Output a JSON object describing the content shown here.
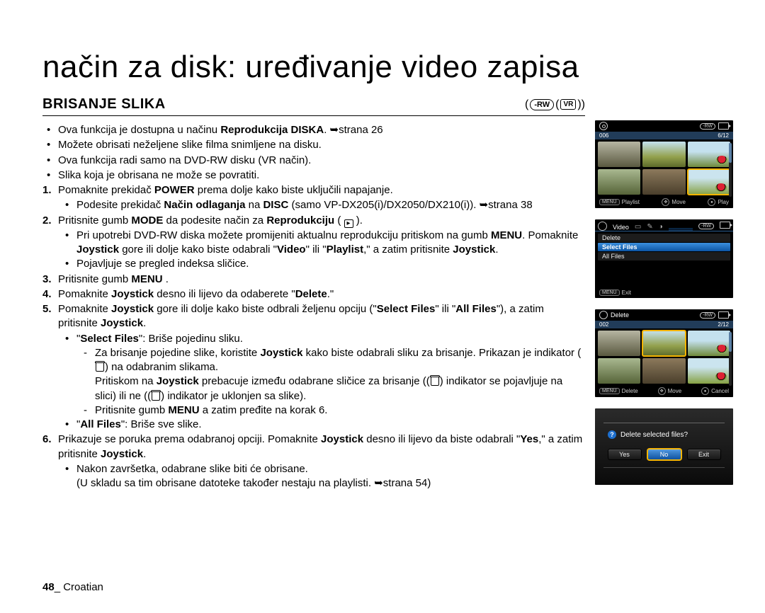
{
  "title": "način za disk: uređivanje video zapisa",
  "section_heading": "BRISANJE SLIKA",
  "badges": {
    "rw": "-RW",
    "vr": "VR"
  },
  "bullets": {
    "b1a": "Ova funkcija je dostupna u načinu ",
    "b1b": "Reprodukcija DISKA",
    "b1c": ". ➥strana 26",
    "b2": "Možete obrisati neželjene slike filma snimljene na disku.",
    "b3": "Ova funkcija radi samo na DVD-RW disku (VR način).",
    "b4": "Slika koja je obrisana ne može se povratiti."
  },
  "steps": {
    "s1a": "Pomaknite prekidač ",
    "s1b": "POWER",
    "s1c": " prema dolje kako biste uključili napajanje.",
    "s1s1a": "Podesite prekidač ",
    "s1s1b": "Način odlaganja",
    "s1s1c": " na ",
    "s1s1d": "DISC",
    "s1s1e": " (samo VP-DX205(i)/DX2050/DX210(i)). ➥strana 38",
    "s2a": "Pritisnite gumb ",
    "s2b": "MODE",
    "s2c": " da podesite način za ",
    "s2d": "Reprodukciju",
    "s2e": " ( ",
    "s2s1a": "Pri upotrebi DVD-RW diska možete promijeniti aktualnu reprodukciju pritiskom na gumb ",
    "s2s1b": "MENU",
    "s2s1c": ". Pomaknite ",
    "s2s1d": "Joystick",
    "s2s1e": " gore ili dolje kako biste odabrali \"",
    "s2s1f": "Video",
    "s2s1g": "\" ili \"",
    "s2s1h": "Playlist",
    "s2s1i": ",\" a zatim pritisnite ",
    "s2s1j": "Joystick",
    "s2s1k": ".",
    "s2s2": "Pojavljuje se pregled indeksa sličice.",
    "s3a": "Pritisnite gumb ",
    "s3b": "MENU",
    "s3c": " .",
    "s4a": "Pomaknite ",
    "s4b": "Joystick",
    "s4c": " desno ili lijevo da odaberete \"",
    "s4d": "Delete",
    "s4e": ".\"",
    "s5a": "Pomaknite ",
    "s5b": "Joystick",
    "s5c": " gore ili dolje kako biste odbrali željenu opciju (\"",
    "s5d": "Select Files",
    "s5e": "\" ili \"",
    "s5f": "All Files",
    "s5g": "\"), a zatim pritisnite ",
    "s5h": "Joystick",
    "s5i": ".",
    "s5s1a": "\"",
    "s5s1b": "Select Files",
    "s5s1c": "\": Briše pojedinu sliku.",
    "s5s1d1a": "Za brisanje pojedine slike, koristite ",
    "s5s1d1b": "Joystick",
    "s5s1d1c": " kako biste odabrali sliku za brisanje. Prikazan je indikator (",
    "s5s1d1d": ") na odabranim slikama.",
    "s5s1d1e": "Pritiskom na ",
    "s5s1d1f": "Joystick",
    "s5s1d1g": " prebacuje između odabrane sličice za brisanje ((",
    "s5s1d1h": ") indikator se pojavljuje na slici) ili ne ((",
    "s5s1d1i": ") indikator je uklonjen sa slike).",
    "s5s1d2a": "Pritisnite gumb ",
    "s5s1d2b": "MENU",
    "s5s1d2c": " a zatim pređite na korak 6.",
    "s5s2a": "\"",
    "s5s2b": "All Files",
    "s5s2c": "\": Briše sve slike.",
    "s6a": "Prikazuje se poruka prema odabranoj opciji. Pomaknite ",
    "s6b": "Joystick",
    "s6c": " desno ili lijevo da biste odabrali \"",
    "s6d": "Yes",
    "s6e": ",\" a zatim pritisnite ",
    "s6f": "Joystick",
    "s6g": ".",
    "s6s1": "Nakon završetka, odabrane slike biti će obrisane.",
    "s6s1b": "(U skladu sa tim obrisane datoteke također nestaju na playlisti. ➥strana 54)"
  },
  "footer": {
    "page": "48",
    "lang": "Croatian"
  },
  "screens": {
    "s1": {
      "folder": "006",
      "counter": "6/12",
      "bottom": {
        "menu": "MENU",
        "label1": "Playlist",
        "move": "Move",
        "play": "Play"
      },
      "rw": "-RW"
    },
    "s2": {
      "tab": "Video",
      "items": {
        "i1": "Delete",
        "i2": "Select Files",
        "i3": "All Files"
      },
      "bottom": {
        "menu": "MENU",
        "exit": "Exit"
      },
      "rw": "-RW"
    },
    "s3": {
      "title": "Delete",
      "folder": "002",
      "counter": "2/12",
      "bottom": {
        "menu": "MENU",
        "label1": "Delete",
        "move": "Move",
        "cancel": "Cancel"
      },
      "rw": "-RW"
    },
    "s4": {
      "msg": "Delete selected files?",
      "yes": "Yes",
      "no": "No",
      "exit": "Exit"
    }
  }
}
